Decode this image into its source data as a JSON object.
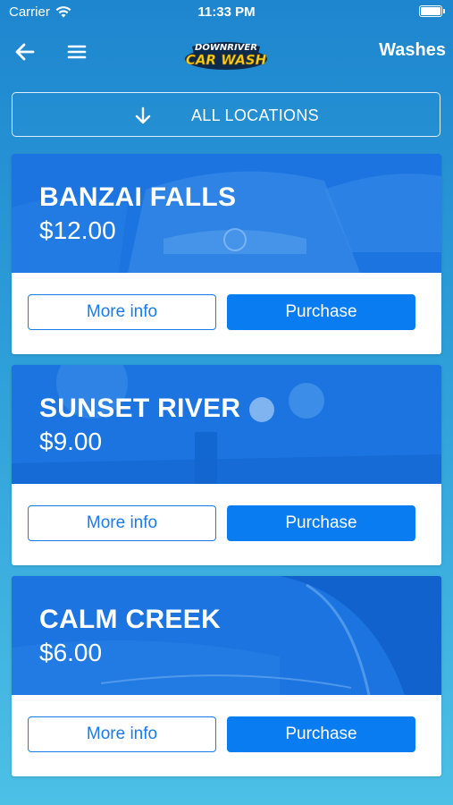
{
  "status_bar": {
    "carrier": "Carrier",
    "time": "11:33 PM"
  },
  "nav": {
    "title": "Washes",
    "logo_line1": "DOWNRIVER",
    "logo_line2": "CAR WASH"
  },
  "location_filter": {
    "label": "ALL LOCATIONS"
  },
  "washes": [
    {
      "name": "BANZAI FALLS",
      "price": "$12.00",
      "more_label": "More info",
      "purchase_label": "Purchase"
    },
    {
      "name": "SUNSET RIVER",
      "price": "$9.00",
      "more_label": "More info",
      "purchase_label": "Purchase"
    },
    {
      "name": "CALM CREEK",
      "price": "$6.00",
      "more_label": "More info",
      "purchase_label": "Purchase"
    }
  ],
  "colors": {
    "accent": "#0a7cf2",
    "hero_overlay": "#1a73e0",
    "logo_yellow": "#f7d21c"
  }
}
